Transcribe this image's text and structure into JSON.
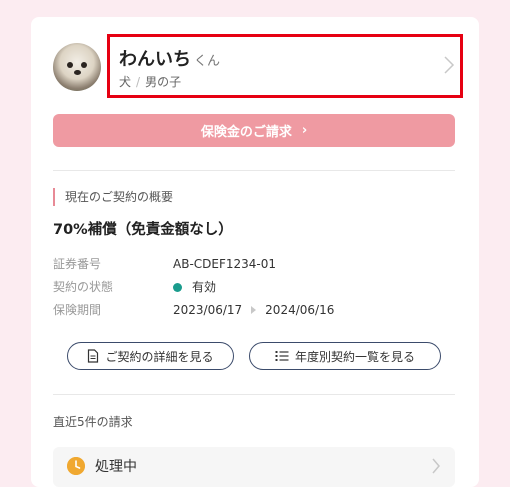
{
  "pet": {
    "name": "わんいち",
    "suffix": "くん",
    "species": "犬",
    "separator": "/",
    "gender": "男の子"
  },
  "claim_button": {
    "label": "保険金のご請求",
    "arrow": "›"
  },
  "contract": {
    "section_title": "現在のご契約の概要",
    "plan_name": "70%補償（免責金額なし）",
    "rows": [
      {
        "label": "証券番号",
        "value": "AB-CDEF1234-01"
      },
      {
        "label": "契約の状態",
        "value": "有効"
      },
      {
        "label": "保険期間",
        "start": "2023/06/17",
        "end": "2024/06/16"
      }
    ],
    "status_color": "#1a9c8d",
    "detail_button": "ご契約の詳細を見る",
    "yearly_button": "年度別契約一覧を見る"
  },
  "recent_claims": {
    "title": "直近5件の請求",
    "items": [
      {
        "status": "処理中",
        "icon": "clock-icon"
      }
    ]
  },
  "colors": {
    "accent_red": "#e60012",
    "button_pink": "#ef9aa2",
    "background": "#fcecf1",
    "status_orange": "#f0a830"
  }
}
